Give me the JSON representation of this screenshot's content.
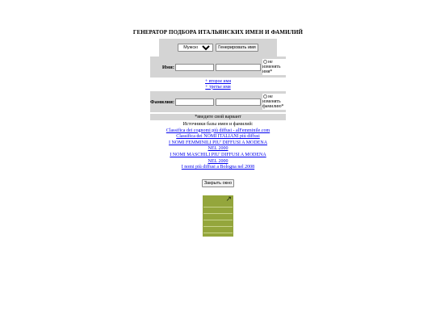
{
  "title": "ГЕНЕРАТОР ПОДБОРА ИТАЛЬЯНСКИХ ИМЕН И ФАМИЛИЙ",
  "generator": {
    "select_value": "Мужское имя",
    "generate_label": "Генерировать имя"
  },
  "name_row": {
    "label": "Имя:",
    "keep_label": "не изменять имя*"
  },
  "name_links": {
    "second": "+ второе имя",
    "third": "+ третье имя"
  },
  "surname_row": {
    "label": "Фамилия:",
    "keep_label": "не изменять фамилию*"
  },
  "note": "*введите свой вариант",
  "sources": {
    "heading": "Источники базы имен и фамилий:",
    "links": [
      "Classifica dei cognomi più diffusi - alFemminile.com",
      "Classifica dei NOMI ITALIANI più diffusi",
      "I NOMI FEMMINILI PIU' DIFFUSI A MODENA",
      "NEL 2000",
      "I NOMI MASCHILI PIU' DIFFUSI A MODENA",
      "NEL 2000",
      "I nomi più diffusi a Bologna nel 2008"
    ]
  },
  "close_label": "Закрыть окно",
  "banner": {
    "color": "#94a63c",
    "icon": "arrow-up-right-icon"
  }
}
